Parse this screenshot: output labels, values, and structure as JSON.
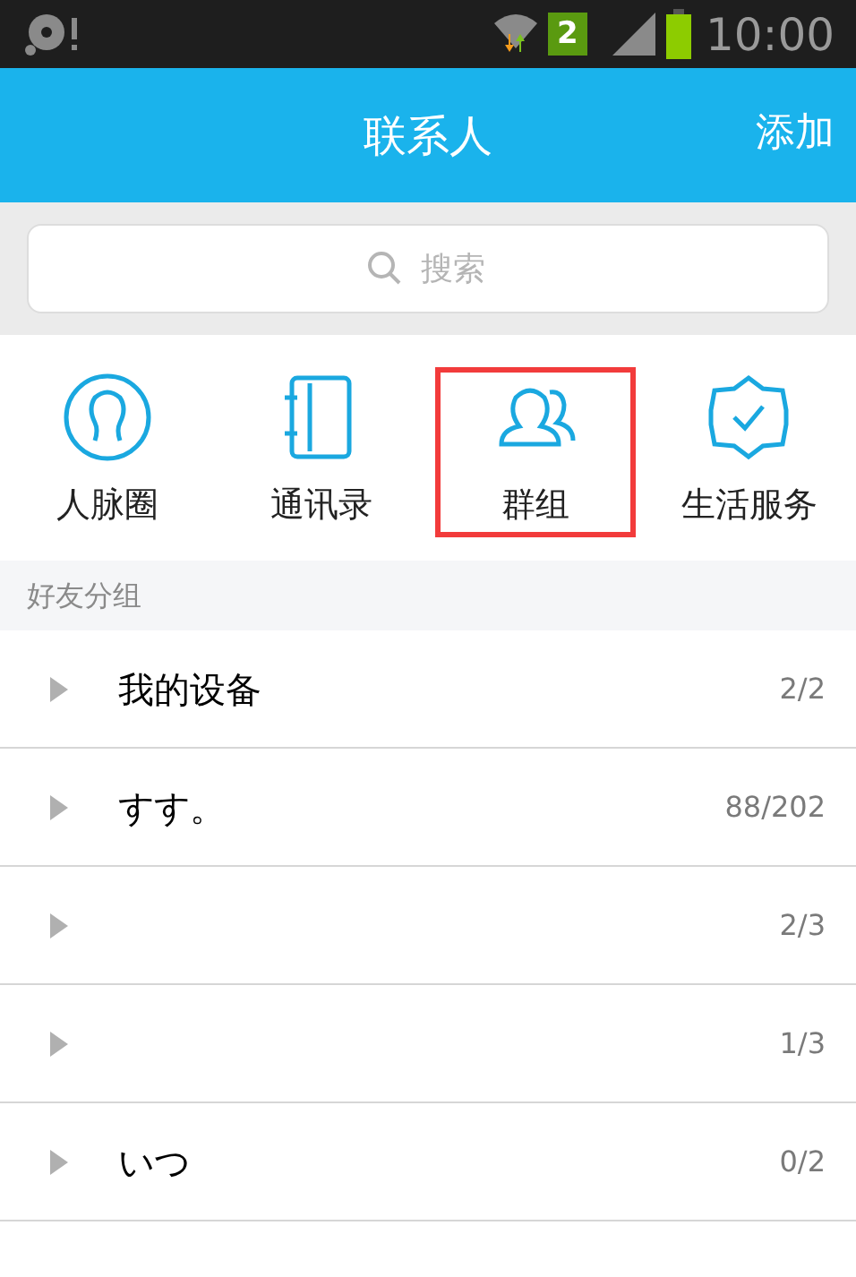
{
  "status_bar": {
    "sim_badge": "2",
    "time": "10:00"
  },
  "header": {
    "title": "联系人",
    "action": "添加"
  },
  "search": {
    "placeholder": "搜索"
  },
  "quick_links": [
    {
      "kind": "circle-person",
      "label": "人脉圈",
      "highlighted": false
    },
    {
      "kind": "notebook",
      "label": "通讯录",
      "highlighted": false
    },
    {
      "kind": "group",
      "label": "群组",
      "highlighted": true
    },
    {
      "kind": "badge-check",
      "label": "生活服务",
      "highlighted": false
    }
  ],
  "section": {
    "title": "好友分组"
  },
  "groups": [
    {
      "name": "我的设备",
      "count": "2/2",
      "expanded": false
    },
    {
      "name": "すす。",
      "count": "88/202",
      "expanded": false
    },
    {
      "count": "2/3",
      "expanded": false
    },
    {
      "count": "1/3",
      "expanded": false
    },
    {
      "name": "いつ",
      "count": "0/2",
      "expanded": false
    }
  ]
}
